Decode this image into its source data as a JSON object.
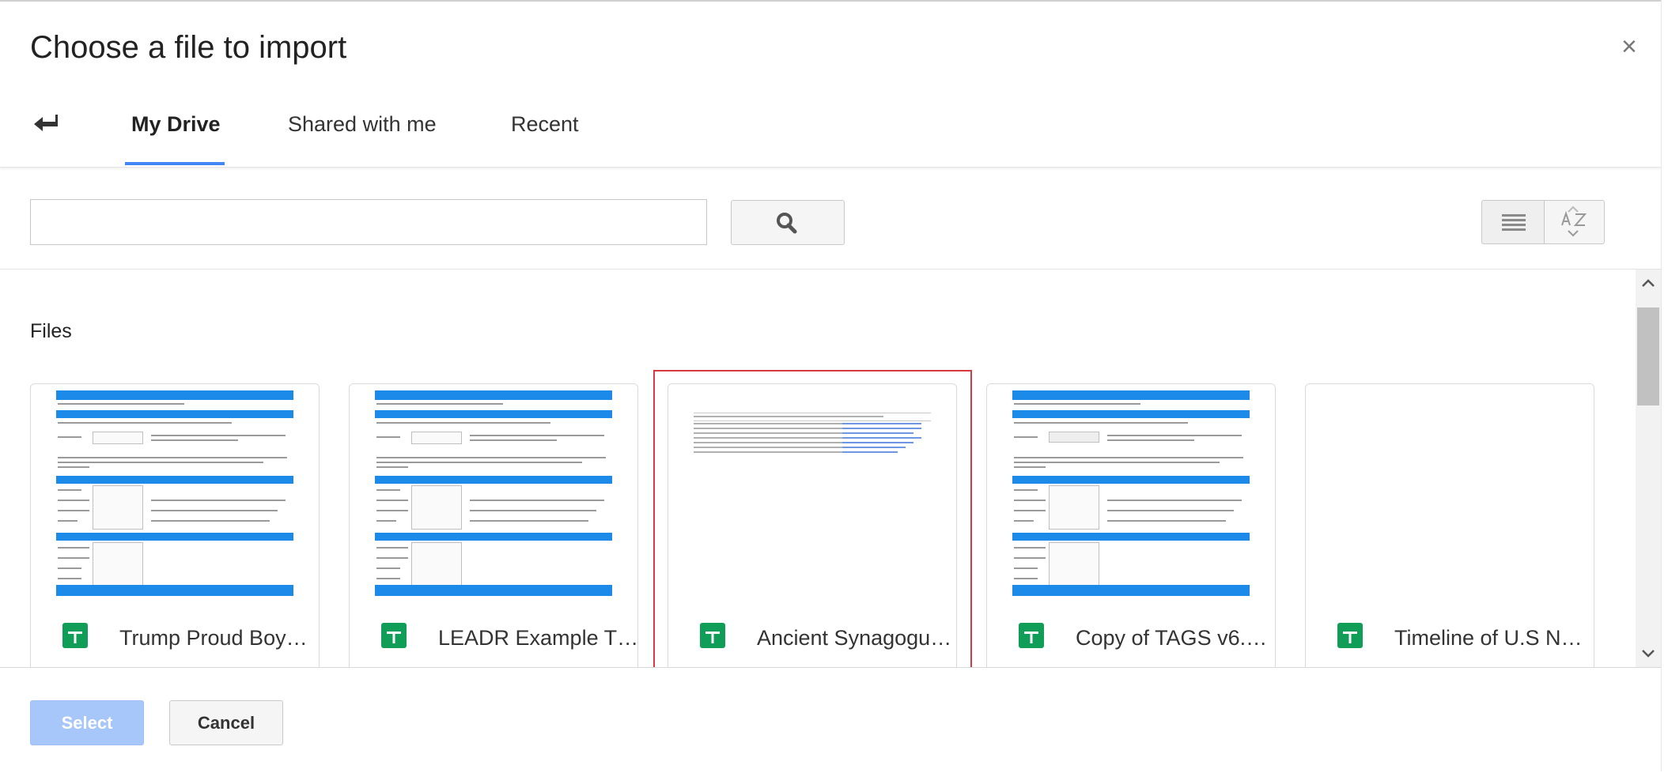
{
  "dialog": {
    "title": "Choose a file to import",
    "close_label": "×"
  },
  "tabs": [
    {
      "label": "My Drive",
      "active": true
    },
    {
      "label": "Shared with me",
      "active": false
    },
    {
      "label": "Recent",
      "active": false
    }
  ],
  "search": {
    "value": "",
    "placeholder": ""
  },
  "icons": {
    "back": "back-arrow-icon",
    "search": "search-icon",
    "list_view": "list-view-icon",
    "sort": "sort-az-icon",
    "close": "close-icon",
    "file_type": "google-sheets-icon"
  },
  "section": {
    "files_label": "Files"
  },
  "files": [
    {
      "name": "Trump Proud Boy…",
      "selected": false
    },
    {
      "name": "LEADR Example T…",
      "selected": false
    },
    {
      "name": "Ancient Synagogu…",
      "selected": true
    },
    {
      "name": "Copy of TAGS v6.…",
      "selected": false
    },
    {
      "name": "Timeline of U.S N…",
      "selected": false
    }
  ],
  "footer": {
    "select_label": "Select",
    "cancel_label": "Cancel"
  },
  "colors": {
    "accent": "#4285f4",
    "sheets_green": "#0f9d58",
    "selection_outline": "#d93a3f",
    "select_button_disabled": "#a7c7fa"
  }
}
